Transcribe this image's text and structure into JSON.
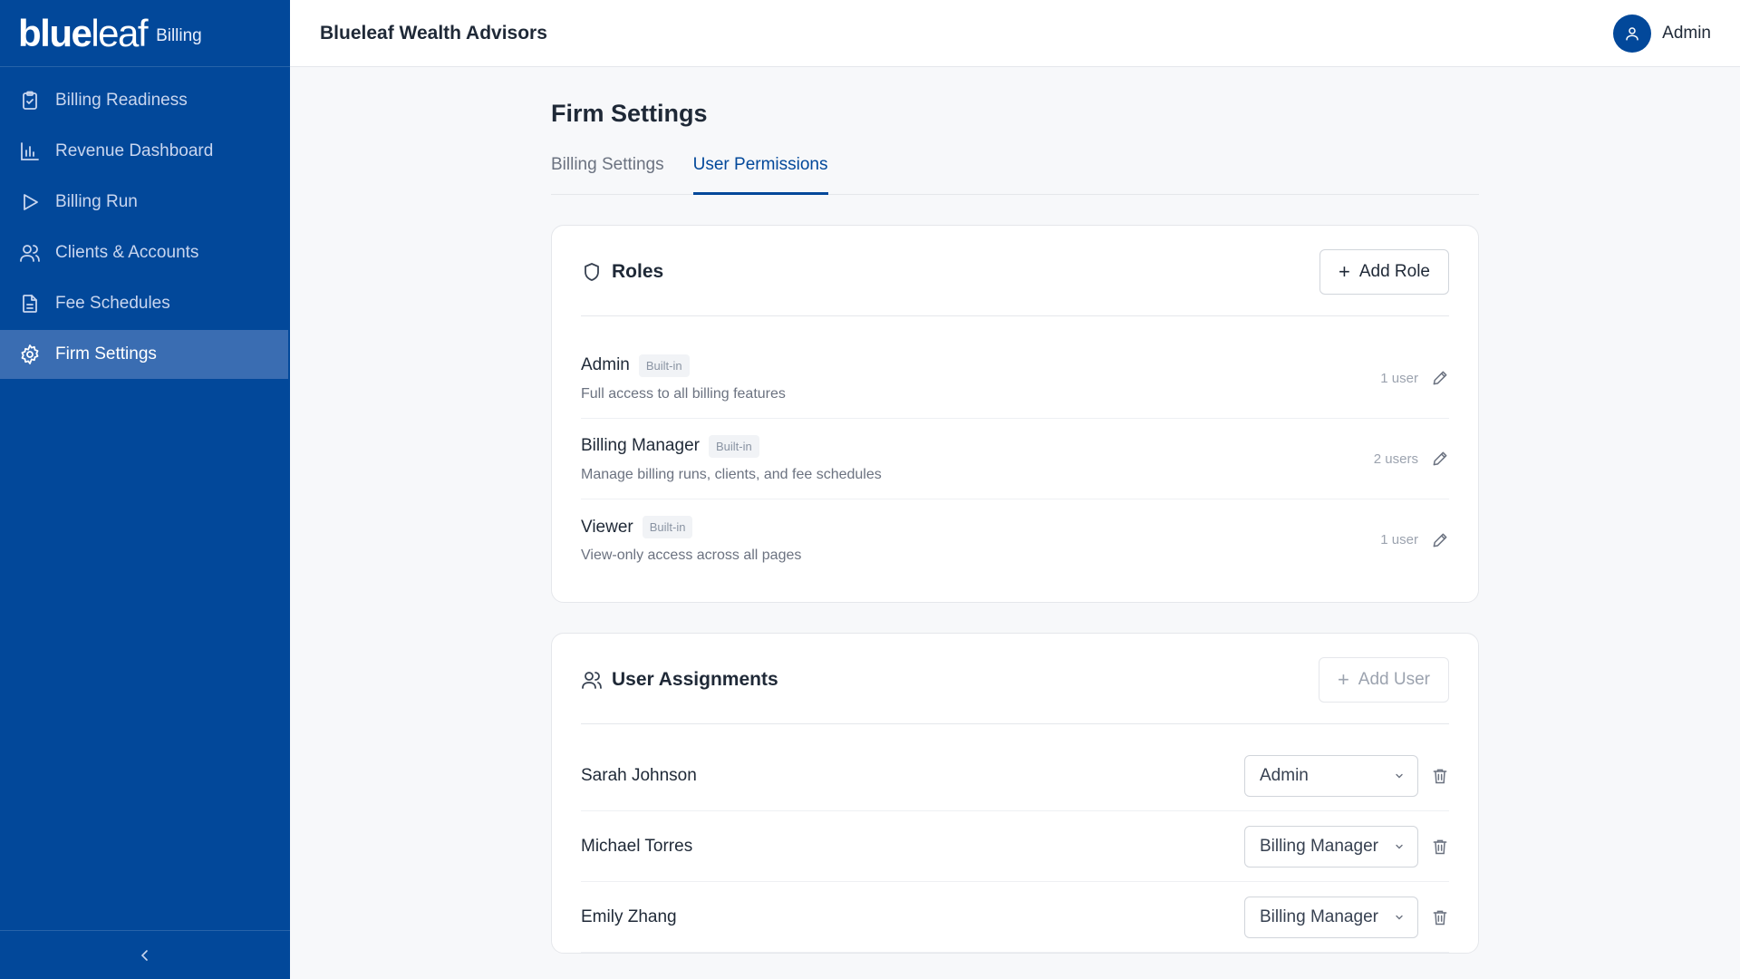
{
  "brand": {
    "logo_bold": "blue",
    "logo_light": "leaf",
    "subtitle": "Billing"
  },
  "sidebar": {
    "items": [
      {
        "label": "Billing Readiness",
        "icon": "clipboard-check-icon"
      },
      {
        "label": "Revenue Dashboard",
        "icon": "bar-chart-icon"
      },
      {
        "label": "Billing Run",
        "icon": "play-icon"
      },
      {
        "label": "Clients & Accounts",
        "icon": "users-icon"
      },
      {
        "label": "Fee Schedules",
        "icon": "document-icon"
      },
      {
        "label": "Firm Settings",
        "icon": "gear-icon",
        "active": true
      }
    ],
    "collapse_icon": "chevron-left-icon"
  },
  "header": {
    "firm_name": "Blueleaf Wealth Advisors",
    "user_name": "Admin",
    "avatar_icon": "user-icon"
  },
  "page": {
    "title": "Firm Settings",
    "tabs": [
      {
        "label": "Billing Settings",
        "active": false
      },
      {
        "label": "User Permissions",
        "active": true
      }
    ]
  },
  "roles": {
    "title": "Roles",
    "icon": "shield-icon",
    "add_button": "Add Role",
    "items": [
      {
        "name": "Admin",
        "badge": "Built-in",
        "description": "Full access to all billing features",
        "users": "1 user"
      },
      {
        "name": "Billing Manager",
        "badge": "Built-in",
        "description": "Manage billing runs, clients, and fee schedules",
        "users": "2 users"
      },
      {
        "name": "Viewer",
        "badge": "Built-in",
        "description": "View-only access across all pages",
        "users": "1 user"
      }
    ]
  },
  "assignments": {
    "title": "User Assignments",
    "icon": "users-icon",
    "add_button": "Add User",
    "items": [
      {
        "name": "Sarah Johnson",
        "role": "Admin"
      },
      {
        "name": "Michael Torres",
        "role": "Billing Manager"
      },
      {
        "name": "Emily Zhang",
        "role": "Billing Manager"
      }
    ]
  },
  "colors": {
    "sidebar_bg": "#02489a",
    "active_nav": "#3a6db2",
    "accent": "#02489a"
  }
}
